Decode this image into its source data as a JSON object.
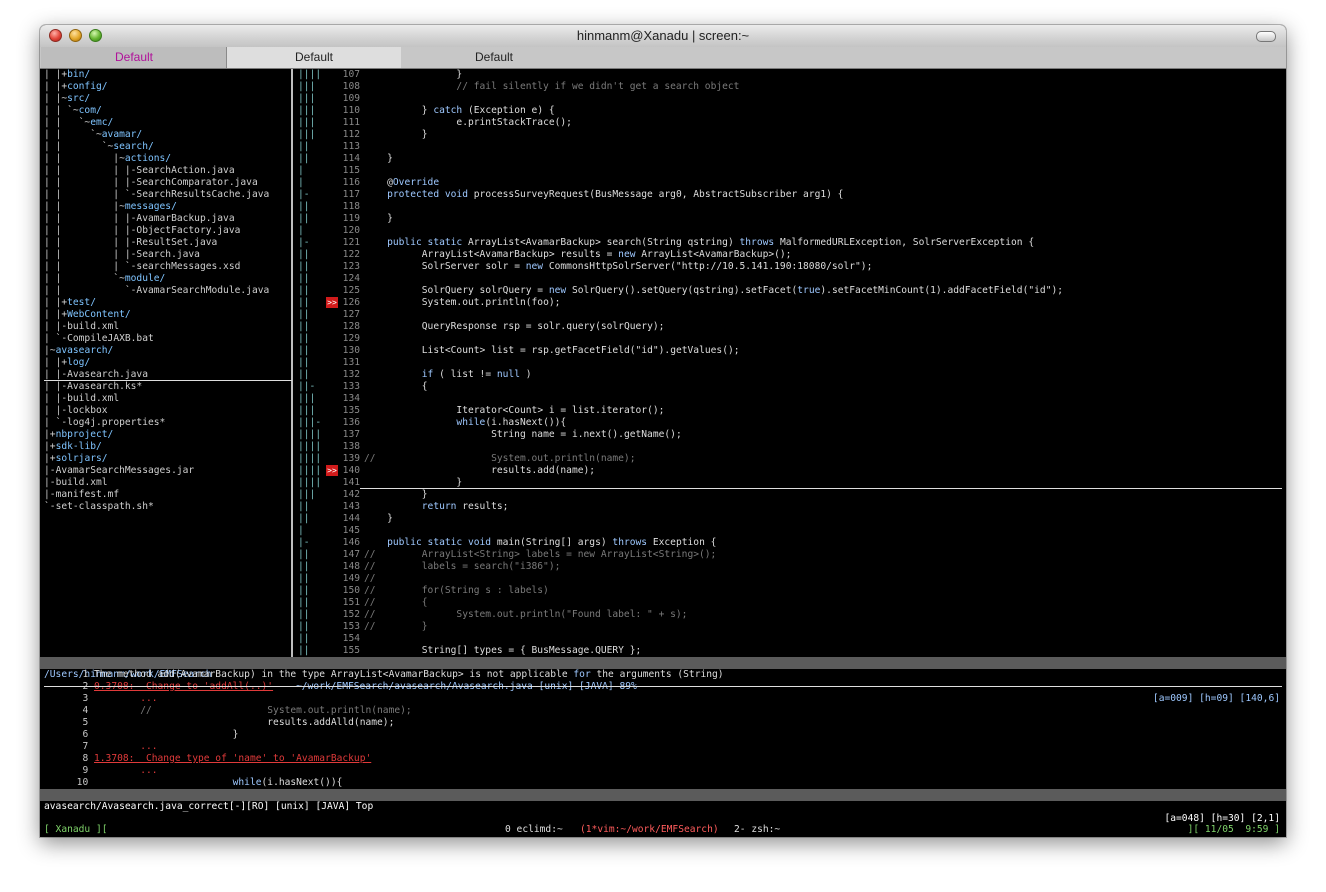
{
  "window": {
    "title": "hinmanm@Xanadu | screen:~"
  },
  "tabs": [
    "Default",
    "Default",
    "Default"
  ],
  "tree": [
    {
      "t": "| |+bin/",
      "dir": false
    },
    {
      "t": "| |+config/",
      "dir": false
    },
    {
      "t": "| |~src/",
      "dir": false
    },
    {
      "t": "| | `~com/",
      "dir": false
    },
    {
      "t": "| |   `~emc/",
      "dir": false
    },
    {
      "t": "| |     `~avamar/",
      "dir": false
    },
    {
      "t": "| |       `~search/",
      "dir": false
    },
    {
      "t": "| |         |~actions/",
      "dir": false
    },
    {
      "t": "| |         | |-SearchAction.java",
      "dir": false
    },
    {
      "t": "| |         | |-SearchComparator.java",
      "dir": false
    },
    {
      "t": "| |         | `-SearchResultsCache.java",
      "dir": false
    },
    {
      "t": "| |         |~messages/",
      "dir": false
    },
    {
      "t": "| |         | |-AvamarBackup.java",
      "dir": false
    },
    {
      "t": "| |         | |-ObjectFactory.java",
      "dir": false
    },
    {
      "t": "| |         | |-ResultSet.java",
      "dir": false
    },
    {
      "t": "| |         | |-Search.java",
      "dir": false
    },
    {
      "t": "| |         | `-searchMessages.xsd",
      "dir": false
    },
    {
      "t": "| |         `~module/",
      "dir": false
    },
    {
      "t": "| |           `-AvamarSearchModule.java",
      "dir": false
    },
    {
      "t": "| |+test/",
      "dir": false
    },
    {
      "t": "| |+WebContent/",
      "dir": false
    },
    {
      "t": "| |-build.xml",
      "dir": false
    },
    {
      "t": "| `-CompileJAXB.bat",
      "dir": false
    },
    {
      "t": "|~avasearch/",
      "dir": false
    },
    {
      "t": "| |+log/",
      "dir": false
    },
    {
      "t": "| |-Avasearch.java",
      "dir": false
    },
    {
      "t": "| |-Avasearch.ks*",
      "dir": false
    },
    {
      "t": "| |-build.xml",
      "dir": false
    },
    {
      "t": "| |-lockbox",
      "dir": false
    },
    {
      "t": "| `-log4j.properties*",
      "dir": false
    },
    {
      "t": "|+nbproject/",
      "dir": false
    },
    {
      "t": "|+sdk-lib/",
      "dir": false
    },
    {
      "t": "|+solrjars/",
      "dir": false
    },
    {
      "t": "|-AvamarSearchMessages.jar",
      "dir": false
    },
    {
      "t": "|-build.xml",
      "dir": false
    },
    {
      "t": "|-manifest.mf",
      "dir": false
    },
    {
      "t": "`-set-classpath.sh*",
      "dir": false
    }
  ],
  "code": [
    {
      "n": "107",
      "f": "||||",
      "t": "                }"
    },
    {
      "n": "108",
      "f": "|||",
      "t": "                // fail silently if we didn't get a search object"
    },
    {
      "n": "109",
      "f": "|||",
      "t": ""
    },
    {
      "n": "110",
      "f": "|||",
      "t": "          } catch (Exception e) {"
    },
    {
      "n": "111",
      "f": "|||",
      "t": "                e.printStackTrace();"
    },
    {
      "n": "112",
      "f": "|||",
      "t": "          }"
    },
    {
      "n": "113",
      "f": "||",
      "t": ""
    },
    {
      "n": "114",
      "f": "||",
      "t": "    }"
    },
    {
      "n": "115",
      "f": "|",
      "t": ""
    },
    {
      "n": "116",
      "f": "|",
      "t": "    @Override"
    },
    {
      "n": "117",
      "f": "|-",
      "t": "    protected void processSurveyRequest(BusMessage arg0, AbstractSubscriber arg1) {"
    },
    {
      "n": "118",
      "f": "||",
      "t": ""
    },
    {
      "n": "119",
      "f": "||",
      "t": "    }"
    },
    {
      "n": "120",
      "f": "|",
      "t": ""
    },
    {
      "n": "121",
      "f": "|-",
      "t": "    public static ArrayList<AvamarBackup> search(String qstring) throws MalformedURLException, SolrServerException {"
    },
    {
      "n": "122",
      "f": "||",
      "t": "          ArrayList<AvamarBackup> results = new ArrayList<AvamarBackup>();"
    },
    {
      "n": "123",
      "f": "||",
      "t": "          SolrServer solr = new CommonsHttpSolrServer(\"http://10.5.141.190:18080/solr\");"
    },
    {
      "n": "124",
      "f": "||",
      "t": ""
    },
    {
      "n": "125",
      "f": "||",
      "t": "          SolrQuery solrQuery = new SolrQuery().setQuery(qstring).setFacet(true).setFacetMinCount(1).addFacetField(\"id\");"
    },
    {
      "n": "126",
      "f": "||",
      "t": "          System.out.println(foo);"
    },
    {
      "n": "127",
      "f": "||",
      "t": ""
    },
    {
      "n": "128",
      "f": "||",
      "t": "          QueryResponse rsp = solr.query(solrQuery);"
    },
    {
      "n": "129",
      "f": "||",
      "t": ""
    },
    {
      "n": "130",
      "f": "||",
      "t": "          List<Count> list = rsp.getFacetField(\"id\").getValues();"
    },
    {
      "n": "131",
      "f": "||",
      "t": ""
    },
    {
      "n": "132",
      "f": "||",
      "t": "          if ( list != null )"
    },
    {
      "n": "133",
      "f": "||-",
      "t": "          {"
    },
    {
      "n": "134",
      "f": "|||",
      "t": ""
    },
    {
      "n": "135",
      "f": "|||",
      "t": "                Iterator<Count> i = list.iterator();"
    },
    {
      "n": "136",
      "f": "|||-",
      "t": "                while(i.hasNext()){"
    },
    {
      "n": "137",
      "f": "||||",
      "t": "                      String name = i.next().getName();"
    },
    {
      "n": "138",
      "f": "||||",
      "t": ""
    },
    {
      "n": "139",
      "f": "||||",
      "t": "//                    System.out.println(name);"
    },
    {
      "n": "140",
      "f": "||||",
      "t": "                      results.add(name);"
    },
    {
      "n": "141",
      "f": "||||",
      "t": "                }"
    },
    {
      "n": "142",
      "f": "|||",
      "t": "          }"
    },
    {
      "n": "143",
      "f": "||",
      "t": "          return results;"
    },
    {
      "n": "144",
      "f": "||",
      "t": "    }"
    },
    {
      "n": "145",
      "f": "|",
      "t": ""
    },
    {
      "n": "146",
      "f": "|-",
      "t": "    public static void main(String[] args) throws Exception {"
    },
    {
      "n": "147",
      "f": "||",
      "t": "//        ArrayList<String> labels = new ArrayList<String>();"
    },
    {
      "n": "148",
      "f": "||",
      "t": "//        labels = search(\"i386\");"
    },
    {
      "n": "149",
      "f": "||",
      "t": "//"
    },
    {
      "n": "150",
      "f": "||",
      "t": "//        for(String s : labels)"
    },
    {
      "n": "151",
      "f": "||",
      "t": "//        {"
    },
    {
      "n": "152",
      "f": "||",
      "t": "//              System.out.println(\"Found label: \" + s);"
    },
    {
      "n": "153",
      "f": "||",
      "t": "//        }"
    },
    {
      "n": "154",
      "f": "||",
      "t": ""
    },
    {
      "n": "155",
      "f": "||",
      "t": "          String[] types = { BusMessage.QUERY };"
    }
  ],
  "markers": [
    "126",
    "140"
  ],
  "status1": {
    "left": "/Users/hinmanm/work/EMFSearch",
    "mid": "~/work/EMFSearch/avasearch/Avasearch.java [unix] [JAVA] 89%",
    "right": "[a=009] [h=09] [140,6]"
  },
  "quickfix": [
    {
      "n": "1",
      "t": "The method add(AvamarBackup) in the type ArrayList<AvamarBackup> is not applicable for the arguments (String)",
      "style": "plain"
    },
    {
      "n": "2",
      "t": "0.3708:  Change to 'addAll(..)'",
      "style": "redu"
    },
    {
      "n": "3",
      "t": "        ...",
      "style": "red"
    },
    {
      "n": "4",
      "t": "        //                    System.out.println(name);",
      "style": "cm"
    },
    {
      "n": "5",
      "t": "                              results.addAlld(name);",
      "style": "plain"
    },
    {
      "n": "6",
      "t": "                        }",
      "style": "plain"
    },
    {
      "n": "7",
      "t": "        ...",
      "style": "red"
    },
    {
      "n": "8",
      "t": "1.3708:  Change type of 'name' to 'AvamarBackup'",
      "style": "redu"
    },
    {
      "n": "9",
      "t": "        ...",
      "style": "red"
    },
    {
      "n": "10",
      "t": "                        while(i.hasNext()){",
      "style": "plain"
    }
  ],
  "status2": {
    "left": "avasearch/Avasearch.java_correct[-][RO] [unix] [JAVA] Top",
    "right": "[a=048] [h=30] [2,1]"
  },
  "screen": {
    "left": "[ Xanadu ][",
    "w0": "0 eclimd:~",
    "w1": "(1*vim:~/work/EMFSearch)",
    "w2": "2- zsh:~",
    "right": "][ 11/05  9:59 ]"
  }
}
